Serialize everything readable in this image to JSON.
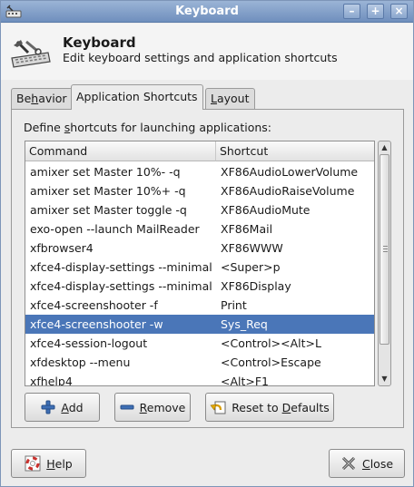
{
  "window": {
    "title": "Keyboard",
    "controls": [
      "–",
      "+",
      "×"
    ]
  },
  "header": {
    "title": "Keyboard",
    "subtitle": "Edit keyboard settings and application shortcuts"
  },
  "tabs": [
    {
      "pre": "Be",
      "u": "h",
      "post": "avior",
      "active": false
    },
    {
      "pre": "Application Shortcuts",
      "u": "",
      "post": "",
      "active": true
    },
    {
      "pre": "",
      "u": "L",
      "post": "ayout",
      "active": false
    }
  ],
  "panel": {
    "label_pre": "Define ",
    "label_u": "s",
    "label_post": "hortcuts for launching applications:"
  },
  "table": {
    "columns": [
      "Command",
      "Shortcut"
    ],
    "rows": [
      {
        "command": "amixer set Master 10%- -q",
        "shortcut": "XF86AudioLowerVolume"
      },
      {
        "command": "amixer set Master 10%+ -q",
        "shortcut": "XF86AudioRaiseVolume"
      },
      {
        "command": "amixer set Master toggle -q",
        "shortcut": "XF86AudioMute"
      },
      {
        "command": "exo-open --launch MailReader",
        "shortcut": "XF86Mail"
      },
      {
        "command": "xfbrowser4",
        "shortcut": "XF86WWW"
      },
      {
        "command": "xfce4-display-settings --minimal",
        "shortcut": "<Super>p"
      },
      {
        "command": "xfce4-display-settings --minimal",
        "shortcut": "XF86Display"
      },
      {
        "command": "xfce4-screenshooter -f",
        "shortcut": "Print"
      },
      {
        "command": "xfce4-screenshooter -w",
        "shortcut": "Sys_Req"
      },
      {
        "command": "xfce4-session-logout",
        "shortcut": "<Control><Alt>L"
      },
      {
        "command": "xfdesktop --menu",
        "shortcut": "<Control>Escape"
      },
      {
        "command": "xfhelp4",
        "shortcut": "<Alt>F1"
      }
    ],
    "selected_row": 8
  },
  "buttons": {
    "add": {
      "u": "A",
      "post": "dd"
    },
    "remove": {
      "u": "R",
      "post": "emove"
    },
    "reset": {
      "pre": "Reset to ",
      "u": "D",
      "post": "efaults"
    },
    "help": {
      "u": "H",
      "post": "elp"
    },
    "close": {
      "u": "C",
      "post": "lose"
    }
  },
  "colors": {
    "selection": "#4a76b8",
    "titlebar": "#7f9cc8"
  }
}
